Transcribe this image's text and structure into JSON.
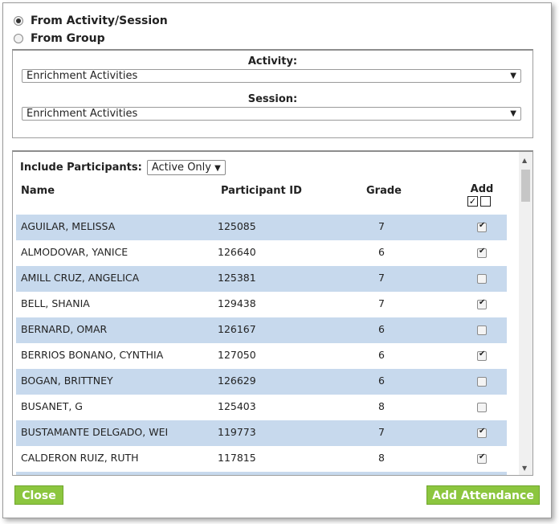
{
  "source": {
    "activity_session_label": "From Activity/Session",
    "group_label": "From Group",
    "selected": "activity_session"
  },
  "filters": {
    "activity_label": "Activity:",
    "activity_value": "Enrichment Activities",
    "session_label": "Session:",
    "session_value": "Enrichment Activities"
  },
  "participants": {
    "include_label": "Include Participants:",
    "include_value": "Active Only",
    "columns": {
      "name": "Name",
      "id": "Participant ID",
      "grade": "Grade",
      "add": "Add"
    },
    "rows": [
      {
        "name": "AGUILAR, MELISSA",
        "id": "125085",
        "grade": "7",
        "checked": true
      },
      {
        "name": "ALMODOVAR, YANICE",
        "id": "126640",
        "grade": "6",
        "checked": true
      },
      {
        "name": "AMILL CRUZ, ANGELICA",
        "id": "125381",
        "grade": "7",
        "checked": false
      },
      {
        "name": "BELL, SHANIA",
        "id": "129438",
        "grade": "7",
        "checked": true
      },
      {
        "name": "BERNARD, OMAR",
        "id": "126167",
        "grade": "6",
        "checked": false
      },
      {
        "name": "BERRIOS BONANO, CYNTHIA",
        "id": "127050",
        "grade": "6",
        "checked": true
      },
      {
        "name": "BOGAN, BRITTNEY",
        "id": "126629",
        "grade": "6",
        "checked": false
      },
      {
        "name": "BUSANET, G",
        "id": "125403",
        "grade": "8",
        "checked": false
      },
      {
        "name": "BUSTAMANTE DELGADO, WEI",
        "id": "119773",
        "grade": "7",
        "checked": true
      },
      {
        "name": "CALDERON RUIZ, RUTH",
        "id": "117815",
        "grade": "8",
        "checked": true
      },
      {
        "name": "",
        "id": "",
        "grade": "",
        "checked": false
      }
    ]
  },
  "buttons": {
    "close": "Close",
    "add_attendance": "Add Attendance"
  },
  "colors": {
    "accent": "#8cc63f",
    "row_stripe": "#c7d9ed"
  }
}
